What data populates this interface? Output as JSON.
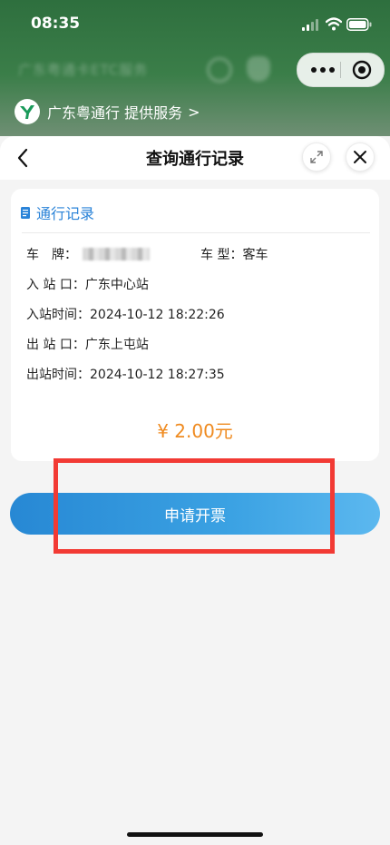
{
  "status_bar": {
    "time": "08:35"
  },
  "host": {
    "blurred_title": "广东粤通卡ETC服务",
    "provider_text": "广东粤通行 提供服务",
    "provider_arrow": ">"
  },
  "nav": {
    "title": "查询通行记录"
  },
  "record": {
    "section_title": "通行记录",
    "plate_label": "车　牌：",
    "type_label": "车 型：",
    "type_value": "客车",
    "entry_station_label": "入 站 口：",
    "entry_station_value": "广东中心站",
    "entry_time_label": "入站时间：",
    "entry_time_value": "2024-10-12 18:22:26",
    "exit_station_label": "出 站 口：",
    "exit_station_value": "广东上屯站",
    "exit_time_label": "出站时间：",
    "exit_time_value": "2024-10-12 18:27:35",
    "amount": "¥ 2.00元"
  },
  "action": {
    "apply_invoice_label": "申请开票"
  },
  "colors": {
    "accent_blue": "#2a83d8",
    "amount_orange": "#ef8a1f",
    "highlight_red": "#f23a34"
  }
}
